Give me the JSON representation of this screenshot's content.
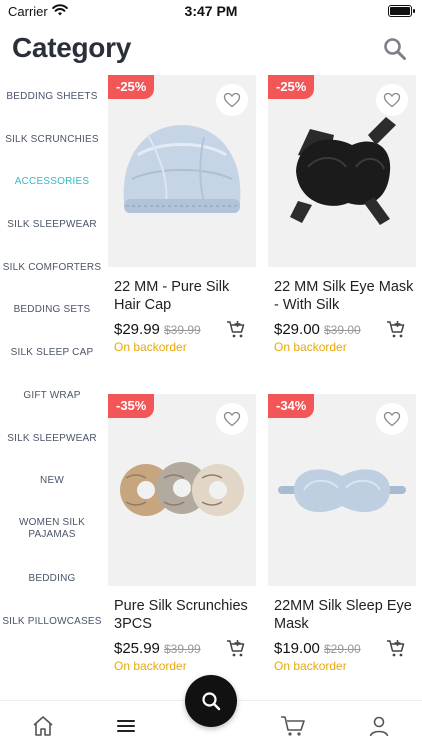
{
  "status": {
    "carrier": "Carrier",
    "time": "3:47 PM"
  },
  "header": {
    "title": "Category"
  },
  "sidebar": {
    "items": [
      {
        "label": "BEDDING SHEETS"
      },
      {
        "label": "SILK SCRUNCHIES"
      },
      {
        "label": "ACCESSORIES",
        "active": true
      },
      {
        "label": "SILK SLEEPWEAR"
      },
      {
        "label": "SILK COMFORTERS"
      },
      {
        "label": "BEDDING SETS"
      },
      {
        "label": "SILK SLEEP CAP"
      },
      {
        "label": "GIFT WRAP"
      },
      {
        "label": "SILK SLEEPWEAR"
      },
      {
        "label": "NEW"
      },
      {
        "label": "WOMEN SILK PAJAMAS"
      },
      {
        "label": "BEDDING"
      },
      {
        "label": "SILK PILLOWCASES"
      }
    ]
  },
  "products": [
    {
      "name": "22 MM - Pure Silk Hair Cap",
      "price": "$29.99",
      "old_price": "$39.99",
      "discount": "-25%",
      "stock": "On backorder",
      "image": "silk-hair-cap"
    },
    {
      "name": "22 MM Silk Eye Mask - With Silk",
      "price": "$29.00",
      "old_price": "$39.00",
      "discount": "-25%",
      "stock": "On backorder",
      "image": "silk-eye-mask-black"
    },
    {
      "name": "Pure Silk Scrunchies 3PCS",
      "price": "$25.99",
      "old_price": "$39.99",
      "discount": "-35%",
      "stock": "On backorder",
      "image": "silk-scrunchies"
    },
    {
      "name": "22MM Silk Sleep Eye Mask",
      "price": "$19.00",
      "old_price": "$29.00",
      "discount": "-34%",
      "stock": "On backorder",
      "image": "silk-sleep-mask-blue"
    }
  ],
  "tabbar": {
    "items": [
      "home-icon",
      "menu-icon",
      "search-icon",
      "cart-icon",
      "profile-icon"
    ]
  },
  "colors": {
    "accent": "#33b9c4",
    "discount": "#f25656",
    "stock": "#e8a80c",
    "fab": "#111111"
  }
}
